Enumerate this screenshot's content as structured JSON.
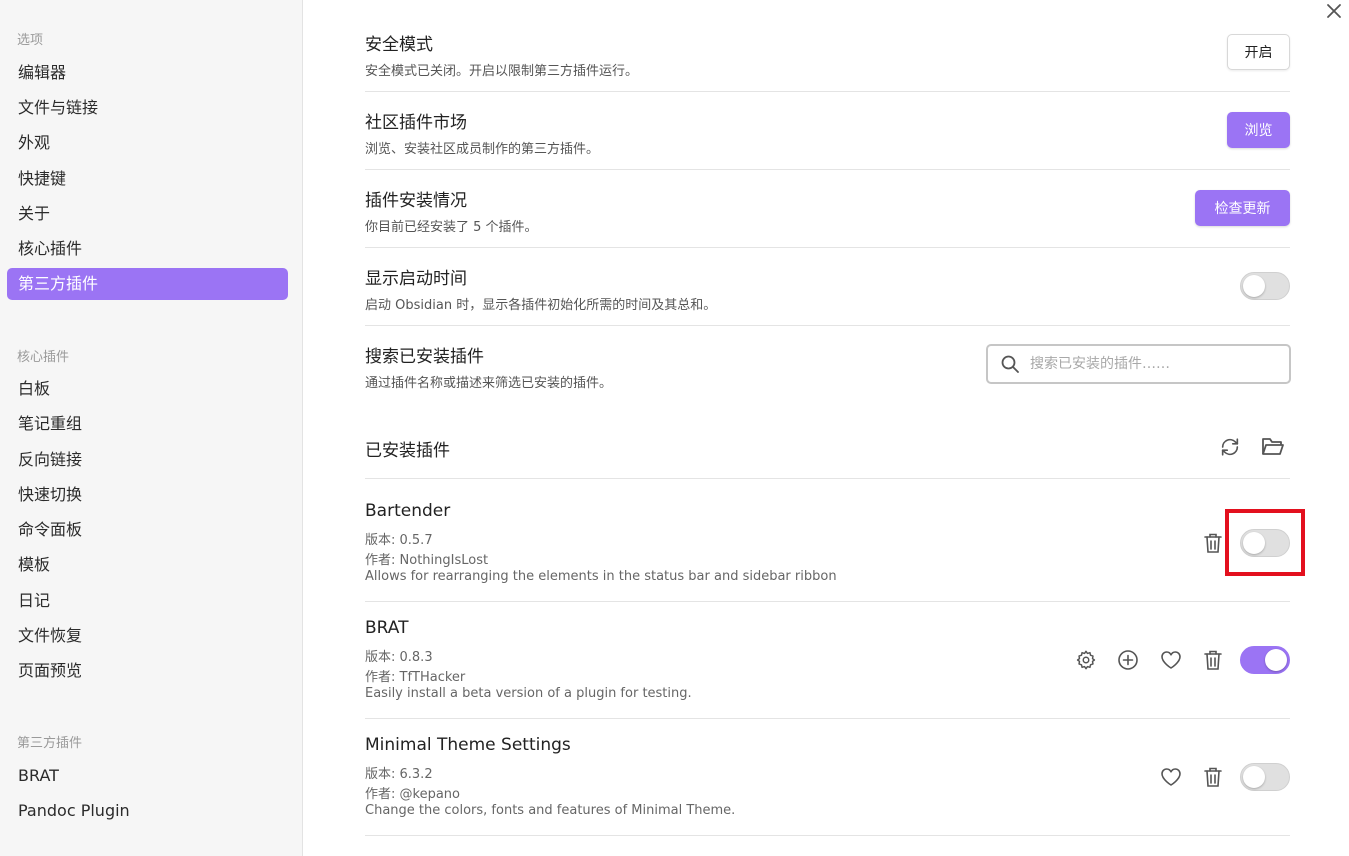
{
  "sidebar": {
    "section_options": "选项",
    "options_items": [
      "编辑器",
      "文件与链接",
      "外观",
      "快捷键",
      "关于",
      "核心插件",
      "第三方插件"
    ],
    "section_core": "核心插件",
    "core_items": [
      "白板",
      "笔记重组",
      "反向链接",
      "快速切换",
      "命令面板",
      "模板",
      "日记",
      "文件恢复",
      "页面预览"
    ],
    "section_community": "第三方插件",
    "community_items": [
      "BRAT",
      "Pandoc Plugin"
    ]
  },
  "settings": {
    "safe_mode": {
      "title": "安全模式",
      "desc": "安全模式已关闭。开启以限制第三方插件运行。",
      "button": "开启"
    },
    "marketplace": {
      "title": "社区插件市场",
      "desc": "浏览、安装社区成员制作的第三方插件。",
      "button": "浏览"
    },
    "installed_status": {
      "title": "插件安装情况",
      "desc": "你目前已经安装了 5 个插件。",
      "button": "检查更新"
    },
    "startup_time": {
      "title": "显示启动时间",
      "desc": "启动 Obsidian 时，显示各插件初始化所需的时间及其总和。",
      "enabled": false
    },
    "search": {
      "title": "搜索已安装插件",
      "desc": "通过插件名称或描述来筛选已安装的插件。",
      "placeholder": "搜索已安装的插件……"
    }
  },
  "installed": {
    "heading": "已安装插件",
    "plugins": [
      {
        "name": "Bartender",
        "version": "版本: 0.5.7",
        "author": "作者: NothingIsLost",
        "desc": "Allows for rearranging the elements in the status bar and sidebar ribbon",
        "enabled": false
      },
      {
        "name": "BRAT",
        "version": "版本: 0.8.3",
        "author": "作者: TfTHacker",
        "desc": "Easily install a beta version of a plugin for testing.",
        "enabled": true
      },
      {
        "name": "Minimal Theme Settings",
        "version": "版本: 6.3.2",
        "author": "作者: @kepano",
        "desc": "Change the colors, fonts and features of Minimal Theme.",
        "enabled": false
      }
    ]
  },
  "colors": {
    "accent": "#9b74f4",
    "highlight": "#e3101e"
  }
}
